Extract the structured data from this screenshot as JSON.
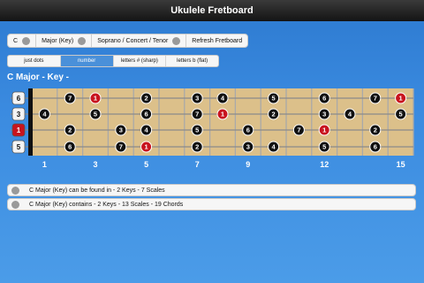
{
  "title": "Ukulele Fretboard",
  "toolbar": {
    "key": "C",
    "mode": "Major (Key)",
    "tuning": "Soprano / Concert / Tenor",
    "refresh": "Refresh Fretboard"
  },
  "tabs": [
    {
      "label": "just dots",
      "active": false
    },
    {
      "label": "number",
      "active": true
    },
    {
      "label": "letters # (sharp)",
      "active": false
    },
    {
      "label": "letters b (flat)",
      "active": false
    }
  ],
  "heading": "C Major - Key -",
  "fretboard": {
    "open_strings": [
      "6",
      "3",
      "1",
      "5"
    ],
    "fret_markers": [
      "1",
      "3",
      "5",
      "7",
      "9",
      "12",
      "15"
    ],
    "colors": {
      "root": "#c8141e",
      "note": "#111111",
      "wood": "#dcc08a"
    },
    "rows": [
      [
        {
          "f": 2,
          "v": "7"
        },
        {
          "f": 3,
          "v": "1",
          "root": true
        },
        {
          "f": 5,
          "v": "2"
        },
        {
          "f": 7,
          "v": "3"
        },
        {
          "f": 8,
          "v": "4"
        },
        {
          "f": 10,
          "v": "5"
        },
        {
          "f": 12,
          "v": "6"
        },
        {
          "f": 14,
          "v": "7"
        },
        {
          "f": 15,
          "v": "1",
          "root": true
        }
      ],
      [
        {
          "f": 1,
          "v": "4"
        },
        {
          "f": 3,
          "v": "5"
        },
        {
          "f": 5,
          "v": "6"
        },
        {
          "f": 7,
          "v": "7"
        },
        {
          "f": 8,
          "v": "1",
          "root": true
        },
        {
          "f": 10,
          "v": "2"
        },
        {
          "f": 12,
          "v": "3"
        },
        {
          "f": 13,
          "v": "4"
        },
        {
          "f": 15,
          "v": "5"
        }
      ],
      [
        {
          "f": 2,
          "v": "2"
        },
        {
          "f": 4,
          "v": "3"
        },
        {
          "f": 5,
          "v": "4"
        },
        {
          "f": 7,
          "v": "5"
        },
        {
          "f": 9,
          "v": "6"
        },
        {
          "f": 11,
          "v": "7"
        },
        {
          "f": 12,
          "v": "1",
          "root": true
        },
        {
          "f": 14,
          "v": "2"
        }
      ],
      [
        {
          "f": 2,
          "v": "6"
        },
        {
          "f": 4,
          "v": "7"
        },
        {
          "f": 5,
          "v": "1",
          "root": true
        },
        {
          "f": 7,
          "v": "2"
        },
        {
          "f": 9,
          "v": "3"
        },
        {
          "f": 10,
          "v": "4"
        },
        {
          "f": 12,
          "v": "5"
        },
        {
          "f": 14,
          "v": "6"
        }
      ]
    ]
  },
  "info": [
    "C Major (Key) can be found in - 2 Keys - 7 Scales",
    "C Major (Key) contains - 2 Keys - 13 Scales - 19 Chords"
  ]
}
